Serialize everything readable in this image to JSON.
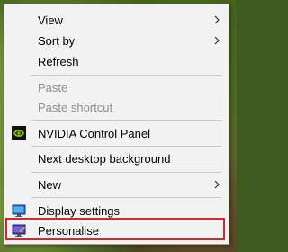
{
  "menu": {
    "items": [
      {
        "label": "View"
      },
      {
        "label": "Sort by"
      },
      {
        "label": "Refresh"
      },
      {
        "label": "Paste"
      },
      {
        "label": "Paste shortcut"
      },
      {
        "label": "NVIDIA Control Panel"
      },
      {
        "label": "Next desktop background"
      },
      {
        "label": "New"
      },
      {
        "label": "Display settings"
      },
      {
        "label": "Personalise"
      }
    ],
    "icons": {
      "nvidia": "nvidia-icon",
      "display": "display-settings-icon",
      "personalise": "personalise-icon",
      "submenu": "chevron-right-icon"
    },
    "colors": {
      "menu_bg": "#f2f2f2",
      "disabled_text": "#8f8f8f",
      "highlight_border": "#d8282b"
    }
  }
}
